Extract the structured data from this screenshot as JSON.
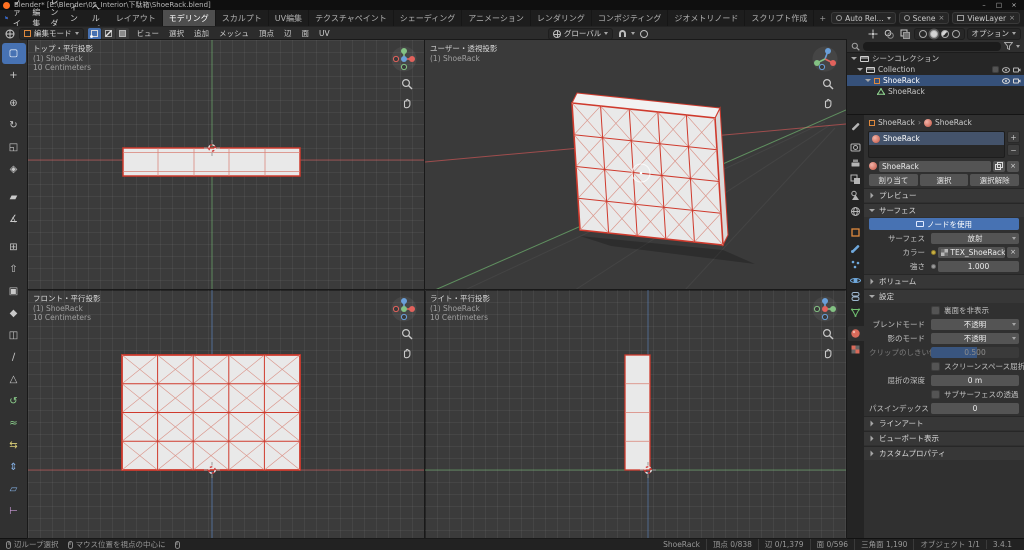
{
  "window": {
    "title": "Blender* [E:\\Blender\\05_Interior\\下駄箱\\ShoeRack.blend]",
    "controls": {
      "minimize": "–",
      "maximize": "□",
      "close": "×"
    }
  },
  "icons": {
    "close": "×",
    "plus": "+",
    "minus": "−",
    "breadcrumb_sep": "›"
  },
  "colors": {
    "accent": "#4772b3",
    "selection_outline": "#cf3a2d",
    "axis_x": "#e2625c",
    "axis_y": "#83c183",
    "axis_z": "#6a9fd8"
  },
  "topbar": {
    "menus": [
      "ファイル",
      "編集",
      "レンダー",
      "ウィンドウ",
      "ヘルプ"
    ],
    "workspaces": [
      "レイアウト",
      "モデリング",
      "スカルプト",
      "UV編集",
      "テクスチャペイント",
      "シェーディング",
      "アニメーション",
      "レンダリング",
      "コンポジティング",
      "ジオメトリノード",
      "スクリプト作成"
    ],
    "active_workspace": "モデリング",
    "auto_rel": "Auto Rel...",
    "scene": "Scene",
    "view_layer": "ViewLayer"
  },
  "tool_header": {
    "mode": "編集モード",
    "menus": [
      "ビュー",
      "選択",
      "追加",
      "メッシュ",
      "頂点",
      "辺",
      "面",
      "UV"
    ],
    "orientation": "グローバル",
    "options": "オプション"
  },
  "left_toolbar": {
    "active_tool": "select-box",
    "tools": [
      "select-box",
      "cursor",
      "move",
      "rotate",
      "scale",
      "transform",
      "annotate",
      "measure",
      "add-cube",
      "extrude-region",
      "inset-faces",
      "bevel",
      "loop-cut",
      "knife",
      "poly-build",
      "spin",
      "smooth",
      "edge-slide",
      "shrink-fatten",
      "shear",
      "rip-region"
    ],
    "glyphs": [
      "▢",
      "+",
      "⊕",
      "↻",
      "◱",
      "◈",
      "▰",
      "∡",
      "⊞",
      "⇧",
      "▣",
      "◆",
      "◫",
      "∕",
      "△",
      "↺",
      "≈",
      "⇆",
      "⇕",
      "▱",
      "⊢"
    ]
  },
  "viewports": {
    "top_left": {
      "view": "トップ・平行投影",
      "object": "(1) ShoeRack",
      "scale": "10 Centimeters"
    },
    "top_right": {
      "view": "ユーザー・透視投影",
      "object": "(1) ShoeRack"
    },
    "bottom_left": {
      "view": "フロント・平行投影",
      "object": "(1) ShoeRack",
      "scale": "10 Centimeters"
    },
    "bottom_right": {
      "view": "ライト・平行投影",
      "object": "(1) ShoeRack",
      "scale": "10 Centimeters"
    }
  },
  "outliner": {
    "rows": [
      {
        "label": "シーンコレクション"
      },
      {
        "label": "Collection"
      },
      {
        "label": "ShoeRack"
      },
      {
        "label": "ShoeRack"
      }
    ]
  },
  "properties": {
    "breadcrumb": {
      "object": "ShoeRack",
      "material": "ShoeRack"
    },
    "slot_name": "ShoeRack",
    "material_name": "ShoeRack",
    "actions": {
      "assign": "割り当て",
      "select": "選択",
      "deselect": "選択解除"
    },
    "panels": {
      "preview": "プレビュー",
      "surface": "サーフェス",
      "volume": "ボリューム",
      "settings": "設定",
      "line_art": "ラインアート",
      "viewport_display": "ビューポート表示",
      "custom_properties": "カスタムプロパティ"
    },
    "surface": {
      "use_nodes": "ノードを使用",
      "surface_label": "サーフェス",
      "surface_value": "放射",
      "color_label": "カラー",
      "color_value": "TEX_ShoeRack.png",
      "strength_label": "強さ",
      "strength_value": "1.000"
    },
    "settings": {
      "backface": "裏面を非表示",
      "blend_label": "ブレンドモード",
      "blend_value": "不透明",
      "shadow_label": "影のモード",
      "shadow_value": "不透明",
      "clip_label": "クリップのしきい値",
      "clip_value": "0.500",
      "ssr": "スクリーンスペース屈折",
      "refraction_label": "屈折の深度",
      "refraction_value": "0 m",
      "sss": "サブサーフェスの透過",
      "pass_label": "パスインデックス",
      "pass_value": "0"
    }
  },
  "statusbar": {
    "hint_select": "辺ループ選択",
    "hint_center": "マウス位置を視点の中心に",
    "object": "ShoeRack",
    "verts": "頂点 0/838",
    "edges": "辺 0/1,379",
    "faces": "面 0/596",
    "tris": "三角面 1,190",
    "objects": "オブジェクト 1/1",
    "version": "3.4.1"
  }
}
